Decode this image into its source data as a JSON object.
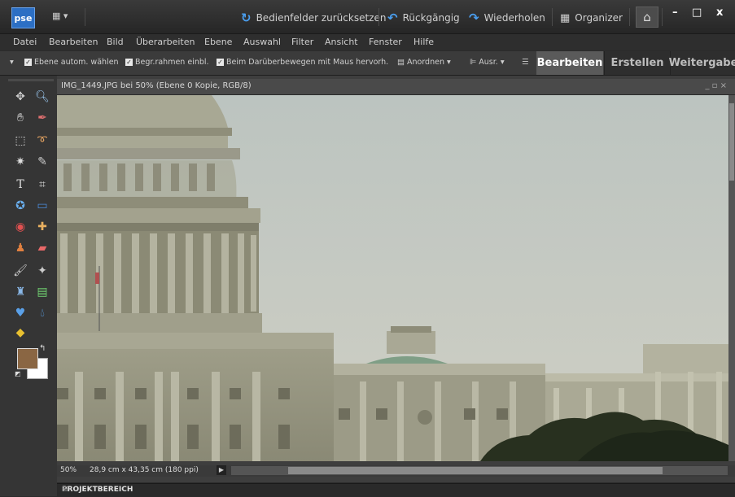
{
  "app": {
    "logo": "pse",
    "layout_icon": "layout-grid-icon"
  },
  "toolbar": {
    "reset_panels": "Bedienfelder zurücksetzen",
    "undo": "Rückgängig",
    "redo": "Wiederholen",
    "organizer": "Organizer",
    "window_controls": {
      "minimize": "–",
      "maximize": "□",
      "close": "x"
    }
  },
  "menu": [
    "Datei",
    "Bearbeiten",
    "Bild",
    "Überarbeiten",
    "Ebene",
    "Auswahl",
    "Filter",
    "Ansicht",
    "Fenster",
    "Hilfe"
  ],
  "options": {
    "auto_select": "Ebene autom. wählen",
    "bounding_box": "Begr.rahmen einbl.",
    "hover_highlight": "Beim Darüberbewegen mit Maus hervorh.",
    "arrange": "Anordnen",
    "align": "Ausr."
  },
  "mode_tabs": {
    "edit": "Bearbeiten",
    "create": "Erstellen",
    "share": "Weitergabe"
  },
  "document": {
    "title": "IMG_1449.JPG bei 50% (Ebene 0 Kopie, RGB/8)",
    "zoom": "50%",
    "dimensions": "28,9 cm x 43,35 cm (180 ppi)"
  },
  "colors": {
    "foreground": "#8a6643",
    "background": "#ffffff",
    "accent": "#2c6fc4"
  },
  "project_bin": "PROJEKTBEREICH"
}
